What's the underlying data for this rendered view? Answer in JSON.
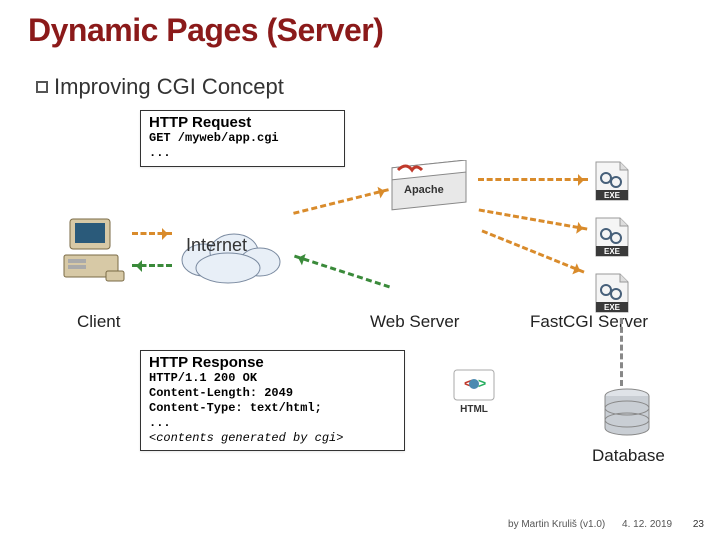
{
  "title": "Dynamic Pages (Server)",
  "heading": "Improving CGI Concept",
  "request": {
    "title": "HTTP Request",
    "line1": "GET /myweb/app.cgi",
    "line2": "..."
  },
  "response": {
    "title": "HTTP Response",
    "line1": "HTTP/1.1 200 OK",
    "line2": "Content-Length: 2049",
    "line3": "Content-Type: text/html;",
    "line4": "...",
    "line5": "<contents generated by cgi>"
  },
  "labels": {
    "internet": "Internet",
    "client": "Client",
    "webserver": "Web Server",
    "fastcgi": "FastCGI Server",
    "database": "Database",
    "exe": "EXE",
    "html": "HTML"
  },
  "server_banner": "Apache",
  "footer": {
    "by": "by Martin Kruliš (v1.0)",
    "date": "4. 12. 2019",
    "page": "23"
  }
}
